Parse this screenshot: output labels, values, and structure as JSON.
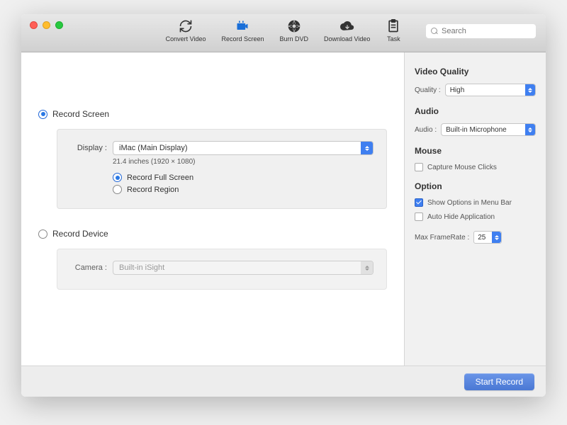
{
  "toolbar": {
    "items": [
      {
        "label": "Convert Video",
        "icon": "convert-icon"
      },
      {
        "label": "Record Screen",
        "icon": "record-icon"
      },
      {
        "label": "Burn DVD",
        "icon": "dvd-icon"
      },
      {
        "label": "Download Video",
        "icon": "download-icon"
      },
      {
        "label": "Task",
        "icon": "task-icon"
      }
    ],
    "search_placeholder": "Search"
  },
  "main": {
    "record_screen": {
      "label": "Record Screen",
      "display_label": "Display :",
      "display_value": "iMac (Main Display)",
      "display_info": "21.4 inches (1920 × 1080)",
      "full_screen_label": "Record Full Screen",
      "region_label": "Record Region"
    },
    "record_device": {
      "label": "Record Device",
      "camera_label": "Camera :",
      "camera_value": "Built-in iSight"
    }
  },
  "side": {
    "video_quality": {
      "heading": "Video Quality",
      "quality_label": "Quality :",
      "quality_value": "High"
    },
    "audio": {
      "heading": "Audio",
      "audio_label": "Audio :",
      "audio_value": "Built-in Microphone"
    },
    "mouse": {
      "heading": "Mouse",
      "capture_label": "Capture Mouse Clicks"
    },
    "option": {
      "heading": "Option",
      "menu_bar_label": "Show Options in Menu Bar",
      "auto_hide_label": "Auto Hide Application",
      "framerate_label": "Max FrameRate :",
      "framerate_value": "25"
    }
  },
  "footer": {
    "start_label": "Start Record"
  }
}
